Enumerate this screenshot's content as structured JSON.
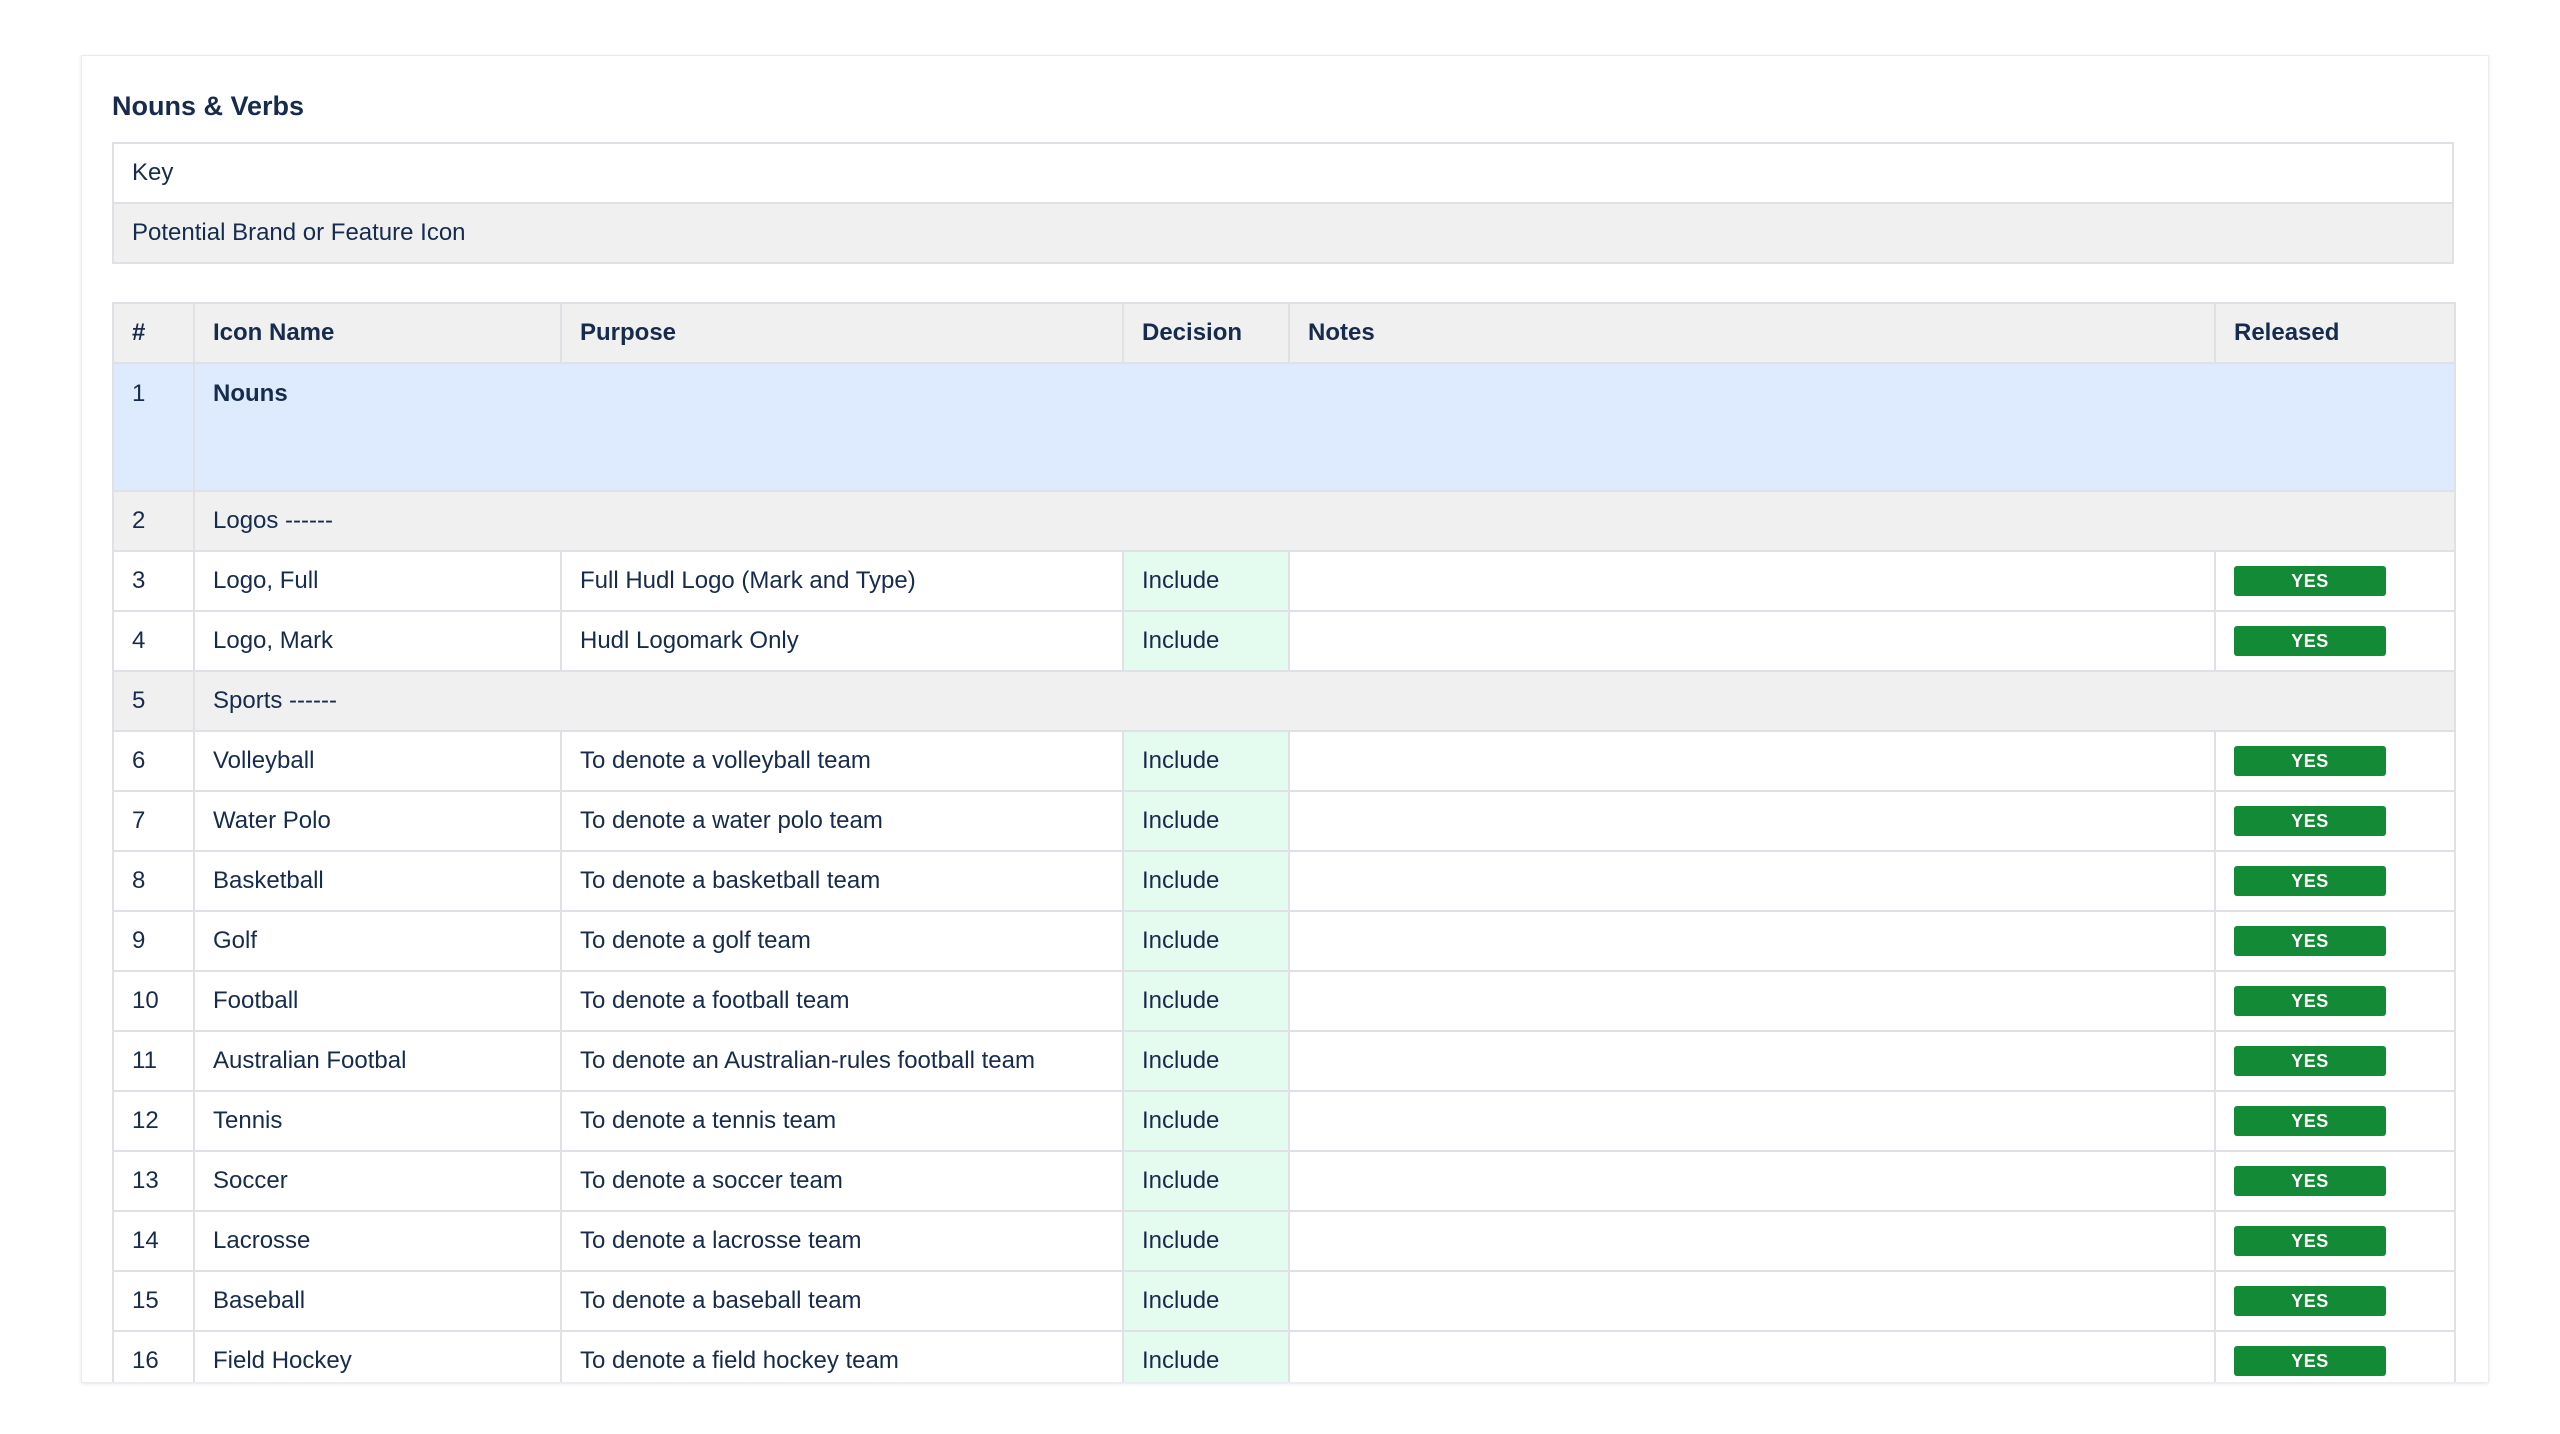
{
  "page": {
    "title": "Nouns & Verbs"
  },
  "key": {
    "header": "Key",
    "legend_label": "Potential Brand or Feature Icon"
  },
  "table": {
    "columns": [
      "#",
      "Icon Name",
      "Purpose",
      "Decision",
      "Notes",
      "Released"
    ],
    "section": {
      "number": "1",
      "label": "Nouns"
    },
    "groups": [
      {
        "number": "2",
        "label": "Logos ------"
      },
      {
        "number": "5",
        "label": "Sports ------"
      }
    ],
    "rows": [
      {
        "number": "3",
        "name": "Logo, Full",
        "purpose": "Full Hudl Logo (Mark and Type)",
        "decision": "Include",
        "notes": "",
        "released": "YES"
      },
      {
        "number": "4",
        "name": "Logo, Mark",
        "purpose": "Hudl Logomark Only",
        "decision": "Include",
        "notes": "",
        "released": "YES"
      },
      {
        "number": "6",
        "name": "Volleyball",
        "purpose": "To denote a volleyball team",
        "decision": "Include",
        "notes": "",
        "released": "YES"
      },
      {
        "number": "7",
        "name": "Water Polo",
        "purpose": "To denote a water polo team",
        "decision": "Include",
        "notes": "",
        "released": "YES"
      },
      {
        "number": "8",
        "name": "Basketball",
        "purpose": "To denote a basketball team",
        "decision": "Include",
        "notes": "",
        "released": "YES"
      },
      {
        "number": "9",
        "name": "Golf",
        "purpose": "To denote a golf team",
        "decision": "Include",
        "notes": "",
        "released": "YES"
      },
      {
        "number": "10",
        "name": "Football",
        "purpose": "To denote a football team",
        "decision": "Include",
        "notes": "",
        "released": "YES"
      },
      {
        "number": "11",
        "name": "Australian Footbal",
        "purpose": "To denote an Australian-rules football team",
        "decision": "Include",
        "notes": "",
        "released": "YES"
      },
      {
        "number": "12",
        "name": "Tennis",
        "purpose": "To denote a tennis team",
        "decision": "Include",
        "notes": "",
        "released": "YES"
      },
      {
        "number": "13",
        "name": "Soccer",
        "purpose": "To denote a soccer team",
        "decision": "Include",
        "notes": "",
        "released": "YES"
      },
      {
        "number": "14",
        "name": "Lacrosse",
        "purpose": "To denote a lacrosse team",
        "decision": "Include",
        "notes": "",
        "released": "YES"
      },
      {
        "number": "15",
        "name": "Baseball",
        "purpose": "To denote a baseball team",
        "decision": "Include",
        "notes": "",
        "released": "YES"
      },
      {
        "number": "16",
        "name": "Field Hockey",
        "purpose": "To denote a field hockey team",
        "decision": "Include",
        "notes": "",
        "released": "YES"
      }
    ]
  },
  "colors": {
    "section_background": "#deebff",
    "group_background": "#f0f0f0",
    "decision_background": "#e3fcef",
    "released_badge": "#138a36"
  }
}
